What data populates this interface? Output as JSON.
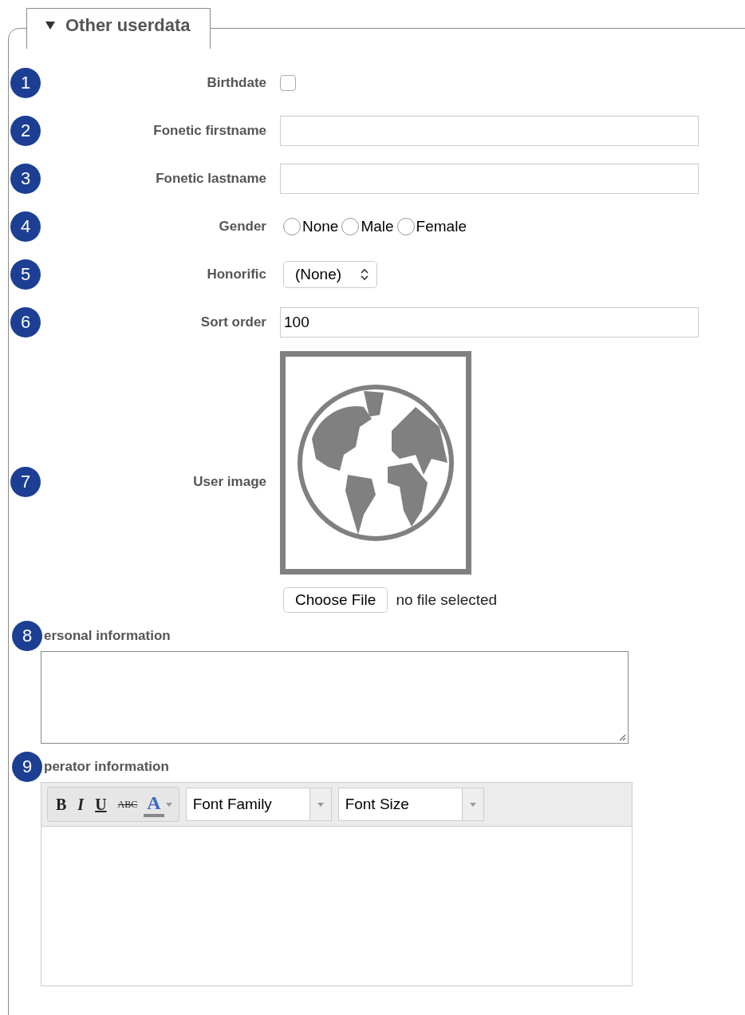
{
  "section": {
    "title": "Other userdata",
    "expanded": true
  },
  "fields": [
    {
      "badge": "1",
      "kind": "checkbox",
      "label": "Birthdate",
      "checked": false
    },
    {
      "badge": "2",
      "kind": "text",
      "label": "Fonetic firstname"
    },
    {
      "badge": "3",
      "kind": "text",
      "label": "Fonetic lastname"
    },
    {
      "badge": "4",
      "kind": "radio",
      "label": "Gender",
      "options": [
        {
          "label": "None",
          "selected": false
        },
        {
          "label": "Male",
          "selected": false
        },
        {
          "label": "Female",
          "selected": false
        }
      ]
    },
    {
      "badge": "5",
      "kind": "select",
      "label": "Honorific",
      "value": "(None)"
    },
    {
      "badge": "6",
      "kind": "text",
      "label": "Sort order",
      "value": "100"
    },
    {
      "badge": "7",
      "kind": "image",
      "label": "User image",
      "button": "Choose File",
      "status": "no file selected"
    }
  ],
  "blocks": [
    {
      "badge": "8",
      "kind": "textarea",
      "label": "ersonal information"
    },
    {
      "badge": "9",
      "kind": "editor",
      "label": "perator information",
      "tools": [
        {
          "kind": "bold",
          "text": "B"
        },
        {
          "kind": "italic",
          "text": "I"
        },
        {
          "kind": "underline",
          "text": "U"
        },
        {
          "kind": "strike",
          "text": "ABC"
        },
        {
          "kind": "color",
          "text": "A"
        }
      ],
      "selects": [
        "Font Family",
        "Font Size"
      ]
    }
  ]
}
